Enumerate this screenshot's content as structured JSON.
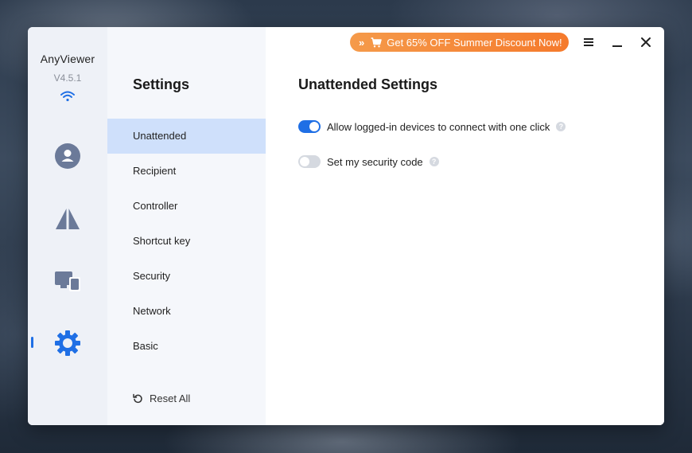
{
  "app": {
    "name": "AnyViewer",
    "version": "V4.5.1"
  },
  "promo": {
    "label": "Get 65% OFF Summer Discount Now!",
    "chevrons": "»",
    "icon": "cart-icon"
  },
  "rail": {
    "items": [
      {
        "icon": "user-icon"
      },
      {
        "icon": "triangle-icon"
      },
      {
        "icon": "devices-icon"
      },
      {
        "icon": "gear-icon",
        "active": true
      }
    ]
  },
  "settings_nav": {
    "title": "Settings",
    "items": [
      {
        "label": "Unattended",
        "active": true
      },
      {
        "label": "Recipient"
      },
      {
        "label": "Controller"
      },
      {
        "label": "Shortcut key"
      },
      {
        "label": "Security"
      },
      {
        "label": "Network"
      },
      {
        "label": "Basic"
      }
    ],
    "reset_label": "Reset All"
  },
  "content": {
    "title": "Unattended Settings",
    "options": [
      {
        "label": "Allow logged-in devices to connect with one click",
        "enabled": true
      },
      {
        "label": "Set my security code",
        "enabled": false
      }
    ],
    "help_glyph": "?"
  },
  "colors": {
    "accent": "#1f6fe5",
    "promo": "#f57a2c",
    "icon_gray": "#6b7a99"
  }
}
